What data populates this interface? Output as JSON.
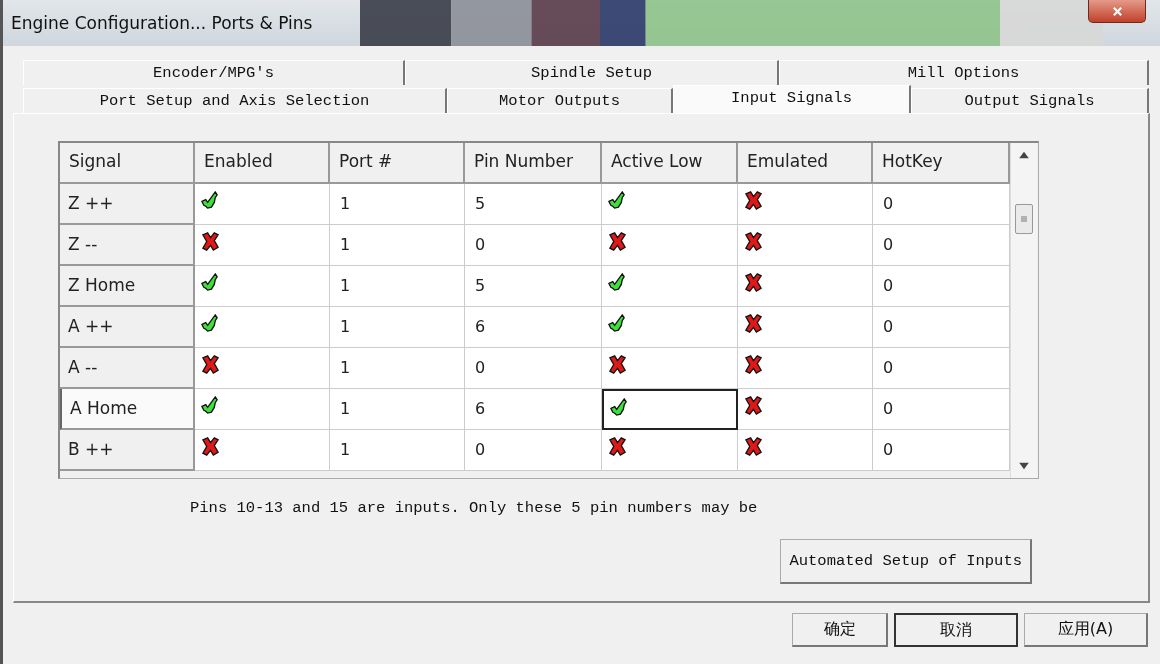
{
  "window": {
    "title": "Engine Configuration... Ports & Pins"
  },
  "tab_rows": [
    [
      {
        "label": "Encoder/MPG's",
        "selected": false
      },
      {
        "label": "Spindle Setup",
        "selected": false
      },
      {
        "label": "Mill Options",
        "selected": false
      }
    ],
    [
      {
        "label": "Port Setup and Axis Selection",
        "selected": false
      },
      {
        "label": "Motor Outputs",
        "selected": false
      },
      {
        "label": "Input Signals",
        "selected": true
      },
      {
        "label": "Output Signals",
        "selected": false
      }
    ]
  ],
  "table": {
    "columns": [
      "Signal",
      "Enabled",
      "Port #",
      "Pin Number",
      "Active Low",
      "Emulated",
      "HotKey"
    ],
    "rows": [
      {
        "signal": "Z ++",
        "enabled": true,
        "port": "1",
        "pin": "5",
        "active_low": true,
        "emulated": false,
        "hotkey": "0",
        "selected": false
      },
      {
        "signal": "Z --",
        "enabled": false,
        "port": "1",
        "pin": "0",
        "active_low": false,
        "emulated": false,
        "hotkey": "0",
        "selected": false
      },
      {
        "signal": "Z Home",
        "enabled": true,
        "port": "1",
        "pin": "5",
        "active_low": true,
        "emulated": false,
        "hotkey": "0",
        "selected": false
      },
      {
        "signal": "A ++",
        "enabled": true,
        "port": "1",
        "pin": "6",
        "active_low": true,
        "emulated": false,
        "hotkey": "0",
        "selected": false
      },
      {
        "signal": "A --",
        "enabled": false,
        "port": "1",
        "pin": "0",
        "active_low": false,
        "emulated": false,
        "hotkey": "0",
        "selected": false
      },
      {
        "signal": "A Home",
        "enabled": true,
        "port": "1",
        "pin": "6",
        "active_low": true,
        "emulated": false,
        "hotkey": "0",
        "selected": true
      },
      {
        "signal": "B ++",
        "enabled": false,
        "port": "1",
        "pin": "0",
        "active_low": false,
        "emulated": false,
        "hotkey": "0",
        "selected": false
      }
    ]
  },
  "note": "Pins 10-13 and 15 are inputs. Only these 5 pin numbers may be",
  "setup_button": "Automated Setup of Inputs",
  "buttons": [
    {
      "label": "确定",
      "focused": false
    },
    {
      "label": "取消",
      "focused": true
    },
    {
      "label": "应用(A)",
      "focused": false
    }
  ]
}
